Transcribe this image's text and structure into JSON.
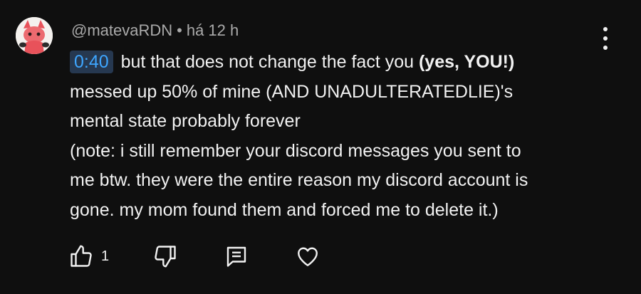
{
  "comment": {
    "author": "@matevaRDN",
    "separator": "•",
    "time": "há 12 h",
    "timestamp_link": "0:40",
    "line1_text": " but that does not change the fact you ",
    "line1_bold": "(yes, YOU!)",
    "line2": "messed up 50% of mine (AND UNADULTERATEDLIE)'s",
    "line3": "mental state probably forever",
    "line4": "(note: i still remember your discord messages you sent to",
    "line5": "me btw. they were the entire reason my discord account is",
    "line6": "gone. my mom found them and forced me to delete it.)"
  },
  "actions": {
    "like_count": "1"
  },
  "icons": {
    "like": "thumbs-up-icon",
    "dislike": "thumbs-down-icon",
    "reply": "reply-comment-icon",
    "heart": "heart-icon",
    "more": "more-vertical-icon"
  },
  "colors": {
    "background": "#0f0f0f",
    "text": "#f1f1f1",
    "muted": "#aaaaaa",
    "timestamp_bg": "#263850",
    "timestamp_fg": "#3ea6ff",
    "avatar_accent": "#e8525a"
  }
}
